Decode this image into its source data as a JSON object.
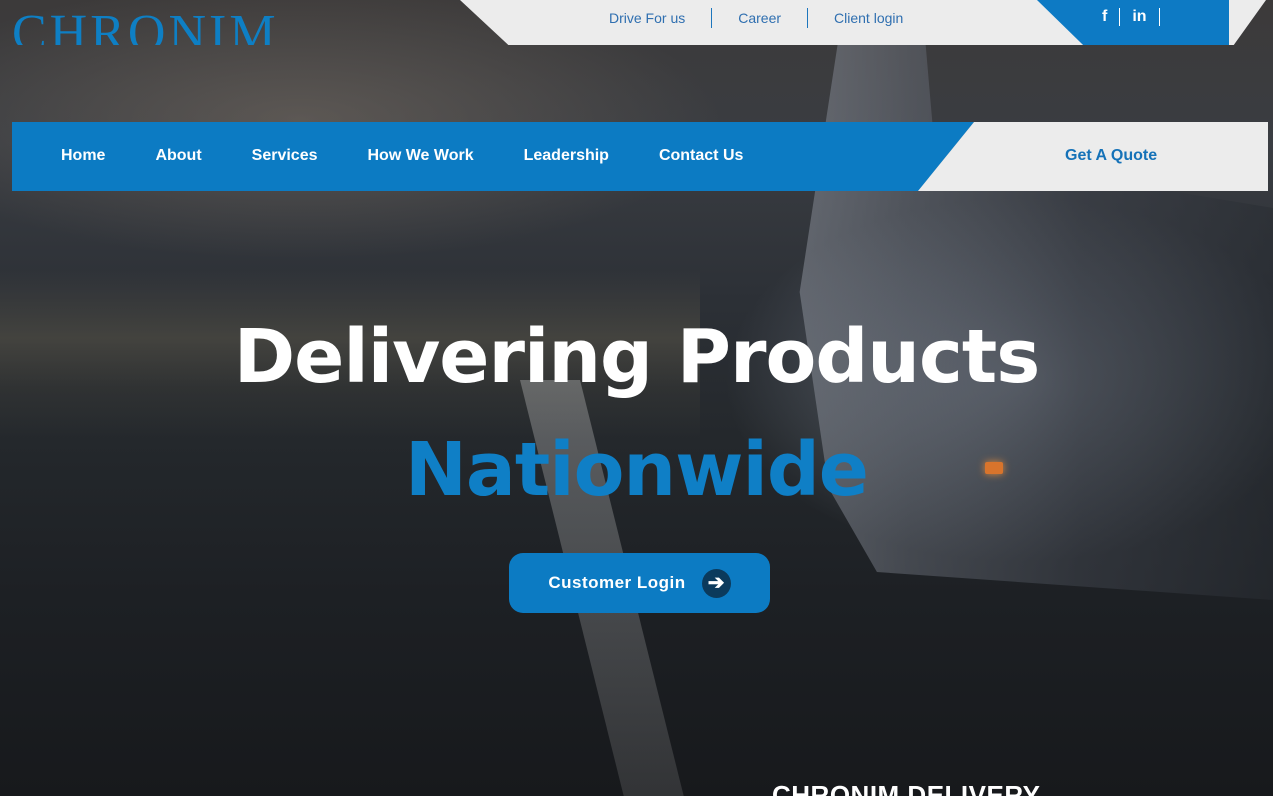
{
  "brand": {
    "logo_text": "CHRONIM"
  },
  "topbar": {
    "links": [
      "Drive For us",
      "Career",
      "Client login"
    ],
    "social": [
      "f",
      "in"
    ]
  },
  "nav": {
    "items": [
      "Home",
      "About",
      "Services",
      "How We Work",
      "Leadership",
      "Contact Us"
    ],
    "quote_label": "Get A Quote"
  },
  "hero": {
    "headline": "Delivering Products",
    "headline_accent": "Nationwide",
    "cta_label": "Customer Login",
    "cta_icon": "arrow-right-icon"
  },
  "section": {
    "heading": "CHRONIM DELIVERY"
  },
  "colors": {
    "brand_blue": "#0c7bc3",
    "light_gray": "#ececec",
    "white": "#ffffff"
  }
}
